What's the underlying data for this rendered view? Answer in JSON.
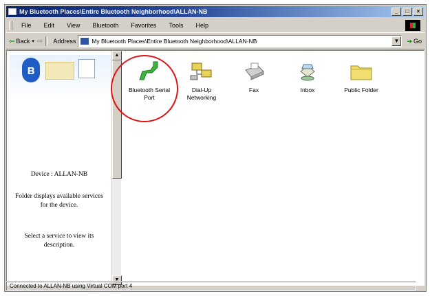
{
  "window": {
    "title": "My Bluetooth Places\\Entire Bluetooth Neighborhood\\ALLAN-NB",
    "caption_buttons": [
      "_",
      "□",
      "×"
    ]
  },
  "menu": [
    "File",
    "Edit",
    "View",
    "Bluetooth",
    "Favorites",
    "Tools",
    "Help"
  ],
  "toolbar": {
    "back_label": "Back",
    "address_label": "Address",
    "address_value": "My Bluetooth Places\\Entire Bluetooth Neighborhood\\ALLAN-NB",
    "go_label": "Go"
  },
  "left_pane": {
    "device_label": "Device : ALLAN-NB",
    "info_text": "Folder displays available services for the device.",
    "hint_text": "Select a service to view its description."
  },
  "services": [
    {
      "label": "Bluetooth Serial Port",
      "icon": "serial-port-icon"
    },
    {
      "label": "Dial-Up Networking",
      "icon": "dialup-networking-icon"
    },
    {
      "label": "Fax",
      "icon": "fax-icon"
    },
    {
      "label": "Inbox",
      "icon": "inbox-icon"
    },
    {
      "label": "Public Folder",
      "icon": "folder-icon"
    }
  ],
  "status": {
    "text": "Connected to ALLAN-NB using Virtual COM port 4"
  },
  "colors": {
    "title_bar": "#0a246a",
    "highlight": "#e01010",
    "bluetooth": "#1f5dc4"
  }
}
